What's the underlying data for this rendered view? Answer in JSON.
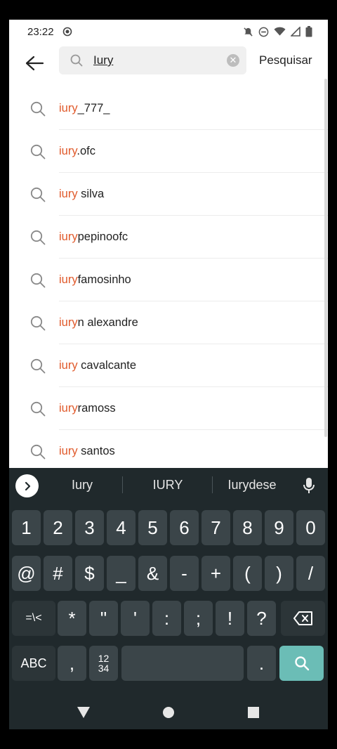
{
  "status": {
    "time": "23:22"
  },
  "search": {
    "query": "Iury",
    "action_label": "Pesquisar",
    "highlight_color": "#e0592a"
  },
  "results": [
    {
      "match": "iury",
      "rest": "_777_"
    },
    {
      "match": "iury",
      "rest": ".ofc"
    },
    {
      "match": "iury",
      "rest": " silva"
    },
    {
      "match": "iury",
      "rest": "pepinoofc"
    },
    {
      "match": "iury",
      "rest": "famosinho"
    },
    {
      "match": "iury",
      "rest": "n alexandre"
    },
    {
      "match": "iury",
      "rest": " cavalcante"
    },
    {
      "match": "iury",
      "rest": "ramoss"
    },
    {
      "match": "iury",
      "rest": " santos"
    }
  ],
  "keyboard": {
    "suggestions": [
      "Iury",
      "IURY",
      "Iurydese"
    ],
    "row1": [
      "1",
      "2",
      "3",
      "4",
      "5",
      "6",
      "7",
      "8",
      "9",
      "0"
    ],
    "row2": [
      "@",
      "#",
      "$",
      "_",
      "&",
      "-",
      "+",
      "(",
      ")",
      "/"
    ],
    "row3": [
      "=\\<",
      "*",
      "\"",
      "'",
      ":",
      ";",
      "!",
      "?"
    ],
    "row4": {
      "abc": "ABC",
      "comma": ",",
      "numpad_top": "12",
      "numpad_bottom": "34",
      "period": "."
    },
    "enter_color": "#6bbdb6",
    "background": "#20292c"
  }
}
